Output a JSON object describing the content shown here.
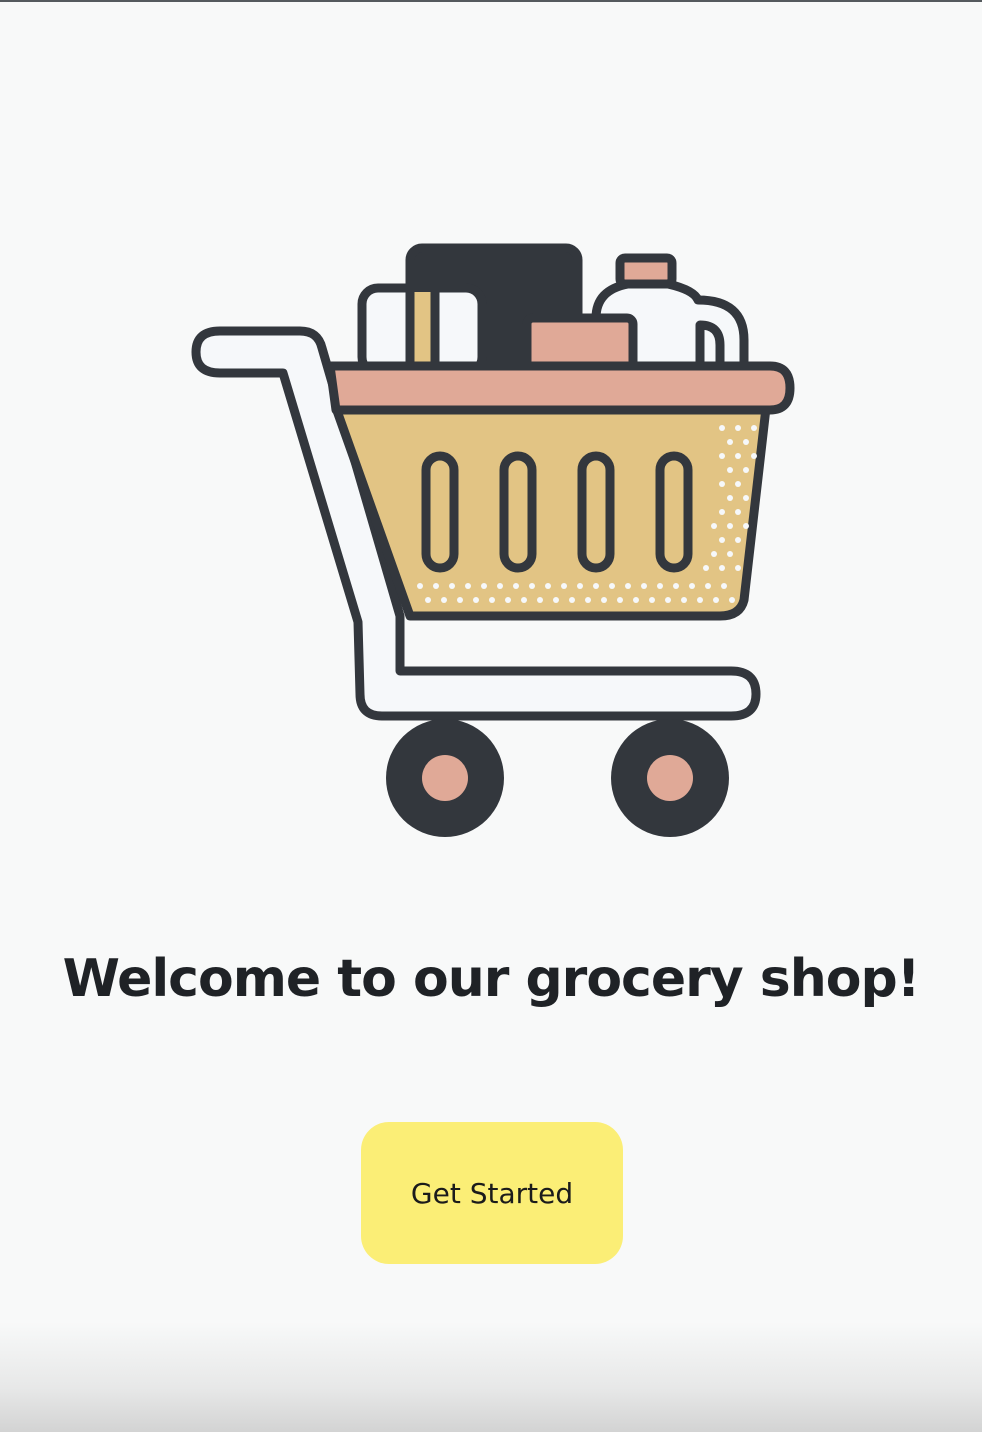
{
  "welcome": {
    "title": "Welcome to our grocery shop!"
  },
  "cta": {
    "label": "Get Started"
  },
  "illustration": {
    "icon": "shopping-cart-icon"
  },
  "colors": {
    "background": "#f8f9f9",
    "button": "#fbee76",
    "outline": "#33373d",
    "basket": "#e2c484",
    "rim": "#e0a997",
    "white": "#f6f8fa"
  }
}
